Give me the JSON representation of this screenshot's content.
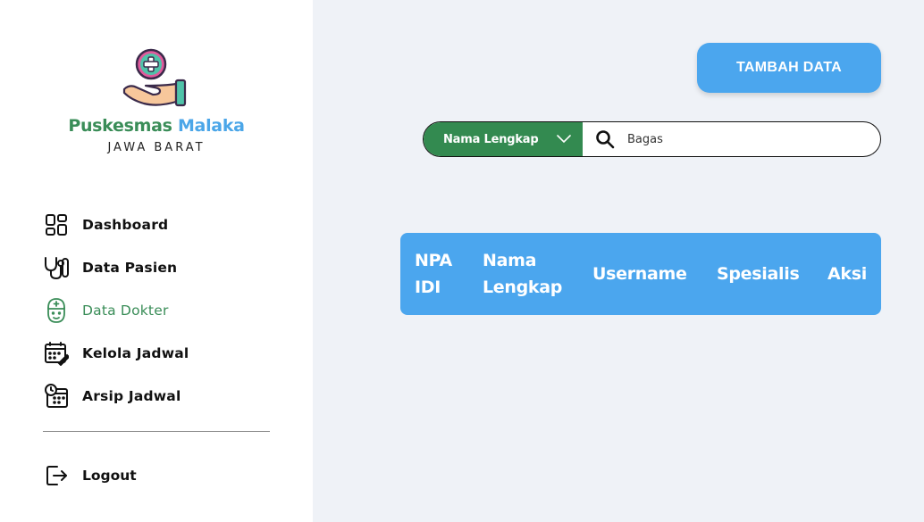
{
  "brand": {
    "name_part1": "Puskesmas",
    "name_part2": "Malaka",
    "region": "JAWA BARAT"
  },
  "nav": [
    {
      "label": "Dashboard",
      "icon": "dashboard-icon"
    },
    {
      "label": "Data Pasien",
      "icon": "stethoscope-icon"
    },
    {
      "label": "Data Dokter",
      "icon": "doctor-icon",
      "active": true
    },
    {
      "label": "Kelola Jadwal",
      "icon": "calendar-edit-icon"
    },
    {
      "label": "Arsip Jadwal",
      "icon": "calendar-clock-icon"
    }
  ],
  "logout": {
    "label": "Logout",
    "icon": "logout-icon"
  },
  "toolbar": {
    "add_label": "TAMBAH DATA"
  },
  "search": {
    "filter_selected": "Nama Lengkap",
    "value": "Bagas"
  },
  "table": {
    "headers": [
      "NPA IDI",
      "Nama Lengkap",
      "Username",
      "Spesialis",
      "Aksi"
    ]
  },
  "colors": {
    "primary_green": "#338a50",
    "primary_blue": "#4ba6ee",
    "background": "#eff2f7"
  }
}
